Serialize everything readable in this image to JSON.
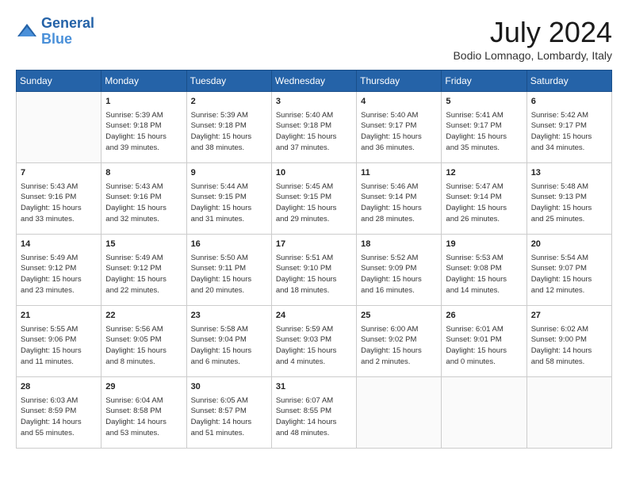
{
  "header": {
    "logo_line1": "General",
    "logo_line2": "Blue",
    "title": "July 2024",
    "location": "Bodio Lomnago, Lombardy, Italy"
  },
  "days_of_week": [
    "Sunday",
    "Monday",
    "Tuesday",
    "Wednesday",
    "Thursday",
    "Friday",
    "Saturday"
  ],
  "weeks": [
    [
      {
        "date": "",
        "info": ""
      },
      {
        "date": "1",
        "info": "Sunrise: 5:39 AM\nSunset: 9:18 PM\nDaylight: 15 hours\nand 39 minutes."
      },
      {
        "date": "2",
        "info": "Sunrise: 5:39 AM\nSunset: 9:18 PM\nDaylight: 15 hours\nand 38 minutes."
      },
      {
        "date": "3",
        "info": "Sunrise: 5:40 AM\nSunset: 9:18 PM\nDaylight: 15 hours\nand 37 minutes."
      },
      {
        "date": "4",
        "info": "Sunrise: 5:40 AM\nSunset: 9:17 PM\nDaylight: 15 hours\nand 36 minutes."
      },
      {
        "date": "5",
        "info": "Sunrise: 5:41 AM\nSunset: 9:17 PM\nDaylight: 15 hours\nand 35 minutes."
      },
      {
        "date": "6",
        "info": "Sunrise: 5:42 AM\nSunset: 9:17 PM\nDaylight: 15 hours\nand 34 minutes."
      }
    ],
    [
      {
        "date": "7",
        "info": "Sunrise: 5:43 AM\nSunset: 9:16 PM\nDaylight: 15 hours\nand 33 minutes."
      },
      {
        "date": "8",
        "info": "Sunrise: 5:43 AM\nSunset: 9:16 PM\nDaylight: 15 hours\nand 32 minutes."
      },
      {
        "date": "9",
        "info": "Sunrise: 5:44 AM\nSunset: 9:15 PM\nDaylight: 15 hours\nand 31 minutes."
      },
      {
        "date": "10",
        "info": "Sunrise: 5:45 AM\nSunset: 9:15 PM\nDaylight: 15 hours\nand 29 minutes."
      },
      {
        "date": "11",
        "info": "Sunrise: 5:46 AM\nSunset: 9:14 PM\nDaylight: 15 hours\nand 28 minutes."
      },
      {
        "date": "12",
        "info": "Sunrise: 5:47 AM\nSunset: 9:14 PM\nDaylight: 15 hours\nand 26 minutes."
      },
      {
        "date": "13",
        "info": "Sunrise: 5:48 AM\nSunset: 9:13 PM\nDaylight: 15 hours\nand 25 minutes."
      }
    ],
    [
      {
        "date": "14",
        "info": "Sunrise: 5:49 AM\nSunset: 9:12 PM\nDaylight: 15 hours\nand 23 minutes."
      },
      {
        "date": "15",
        "info": "Sunrise: 5:49 AM\nSunset: 9:12 PM\nDaylight: 15 hours\nand 22 minutes."
      },
      {
        "date": "16",
        "info": "Sunrise: 5:50 AM\nSunset: 9:11 PM\nDaylight: 15 hours\nand 20 minutes."
      },
      {
        "date": "17",
        "info": "Sunrise: 5:51 AM\nSunset: 9:10 PM\nDaylight: 15 hours\nand 18 minutes."
      },
      {
        "date": "18",
        "info": "Sunrise: 5:52 AM\nSunset: 9:09 PM\nDaylight: 15 hours\nand 16 minutes."
      },
      {
        "date": "19",
        "info": "Sunrise: 5:53 AM\nSunset: 9:08 PM\nDaylight: 15 hours\nand 14 minutes."
      },
      {
        "date": "20",
        "info": "Sunrise: 5:54 AM\nSunset: 9:07 PM\nDaylight: 15 hours\nand 12 minutes."
      }
    ],
    [
      {
        "date": "21",
        "info": "Sunrise: 5:55 AM\nSunset: 9:06 PM\nDaylight: 15 hours\nand 11 minutes."
      },
      {
        "date": "22",
        "info": "Sunrise: 5:56 AM\nSunset: 9:05 PM\nDaylight: 15 hours\nand 8 minutes."
      },
      {
        "date": "23",
        "info": "Sunrise: 5:58 AM\nSunset: 9:04 PM\nDaylight: 15 hours\nand 6 minutes."
      },
      {
        "date": "24",
        "info": "Sunrise: 5:59 AM\nSunset: 9:03 PM\nDaylight: 15 hours\nand 4 minutes."
      },
      {
        "date": "25",
        "info": "Sunrise: 6:00 AM\nSunset: 9:02 PM\nDaylight: 15 hours\nand 2 minutes."
      },
      {
        "date": "26",
        "info": "Sunrise: 6:01 AM\nSunset: 9:01 PM\nDaylight: 15 hours\nand 0 minutes."
      },
      {
        "date": "27",
        "info": "Sunrise: 6:02 AM\nSunset: 9:00 PM\nDaylight: 14 hours\nand 58 minutes."
      }
    ],
    [
      {
        "date": "28",
        "info": "Sunrise: 6:03 AM\nSunset: 8:59 PM\nDaylight: 14 hours\nand 55 minutes."
      },
      {
        "date": "29",
        "info": "Sunrise: 6:04 AM\nSunset: 8:58 PM\nDaylight: 14 hours\nand 53 minutes."
      },
      {
        "date": "30",
        "info": "Sunrise: 6:05 AM\nSunset: 8:57 PM\nDaylight: 14 hours\nand 51 minutes."
      },
      {
        "date": "31",
        "info": "Sunrise: 6:07 AM\nSunset: 8:55 PM\nDaylight: 14 hours\nand 48 minutes."
      },
      {
        "date": "",
        "info": ""
      },
      {
        "date": "",
        "info": ""
      },
      {
        "date": "",
        "info": ""
      }
    ]
  ]
}
